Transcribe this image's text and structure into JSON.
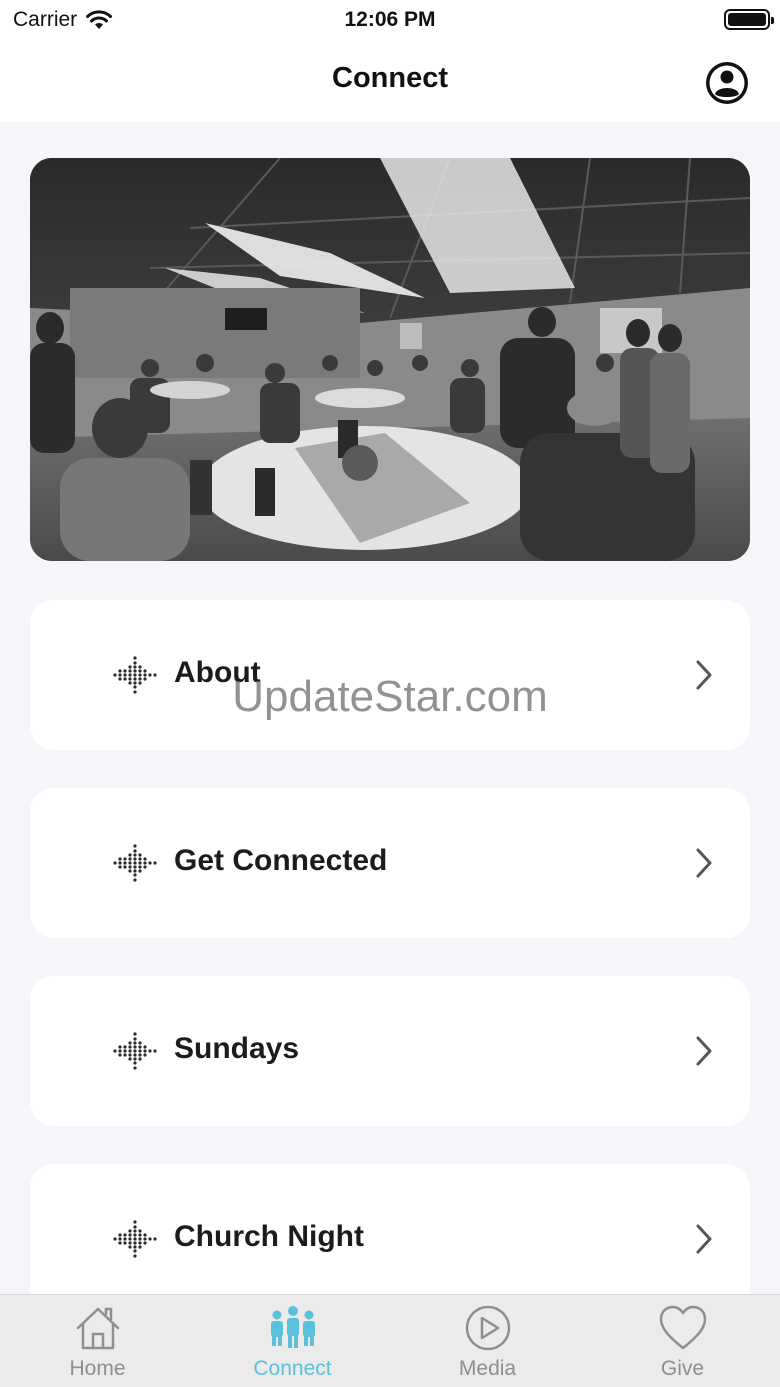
{
  "status_bar": {
    "carrier": "Carrier",
    "time": "12:06 PM"
  },
  "nav": {
    "title": "Connect",
    "profile_icon": "user-circle-icon"
  },
  "hero": {
    "image": "photo of people seated at round tables in a community room (grayscale)"
  },
  "menu": {
    "items": [
      {
        "label": "About",
        "icon": "dot-grid-icon"
      },
      {
        "label": "Get Connected",
        "icon": "dot-grid-icon"
      },
      {
        "label": "Sundays",
        "icon": "dot-grid-icon"
      },
      {
        "label": "Church Night",
        "icon": "dot-grid-icon"
      }
    ]
  },
  "watermark": "UpdateStar.com",
  "tabs": [
    {
      "label": "Home",
      "icon": "home-icon",
      "active": false
    },
    {
      "label": "Connect",
      "icon": "people-icon",
      "active": true
    },
    {
      "label": "Media",
      "icon": "play-icon",
      "active": false
    },
    {
      "label": "Give",
      "icon": "heart-icon",
      "active": false
    }
  ],
  "colors": {
    "accent": "#5ac0dc",
    "background": "#f4f6f9",
    "inactive_tab": "#8e8e93"
  }
}
